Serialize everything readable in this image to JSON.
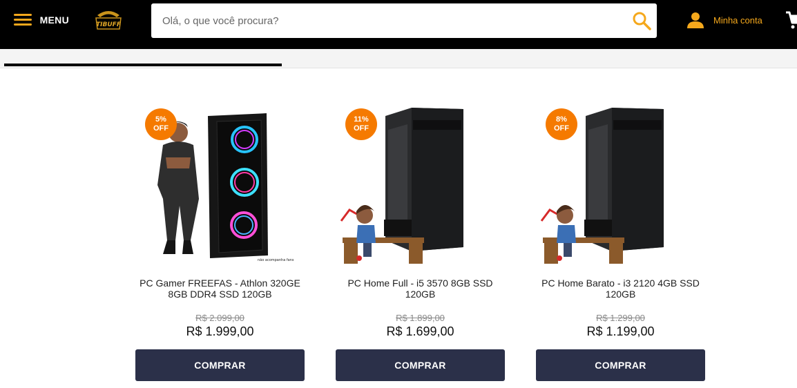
{
  "header": {
    "menu_label": "MENU",
    "logo_text": "TIBUFF",
    "search": {
      "placeholder": "Olá, o que você procura?",
      "value": ""
    },
    "account_label": "Minha conta"
  },
  "colors": {
    "header_bg": "#000000",
    "accent": "#f5a81c",
    "badge": "#f57a00",
    "button": "#2b3049"
  },
  "products": [
    {
      "name": "PC Gamer FREEFAS - Athlon 320GE 8GB DDR4 SSD 120GB",
      "discount_pct": "5%",
      "discount_label": "OFF",
      "old_price": "R$ 2.099,00",
      "price": "R$ 1.999,00",
      "button": "COMPRAR",
      "image_note": "não acompanha fans",
      "image": "gamer-pc-with-character"
    },
    {
      "name": "PC Home Full - i5 3570 8GB SSD 120GB",
      "discount_pct": "11%",
      "discount_label": "OFF",
      "old_price": "R$ 1.899,00",
      "price": "R$ 1.699,00",
      "button": "COMPRAR",
      "image": "desktop-tower-with-person-at-desk"
    },
    {
      "name": "PC Home Barato - i3 2120 4GB SSD 120GB",
      "discount_pct": "8%",
      "discount_label": "OFF",
      "old_price": "R$ 1.299,00",
      "price": "R$ 1.199,00",
      "button": "COMPRAR",
      "image": "desktop-tower-with-person-at-desk"
    }
  ]
}
